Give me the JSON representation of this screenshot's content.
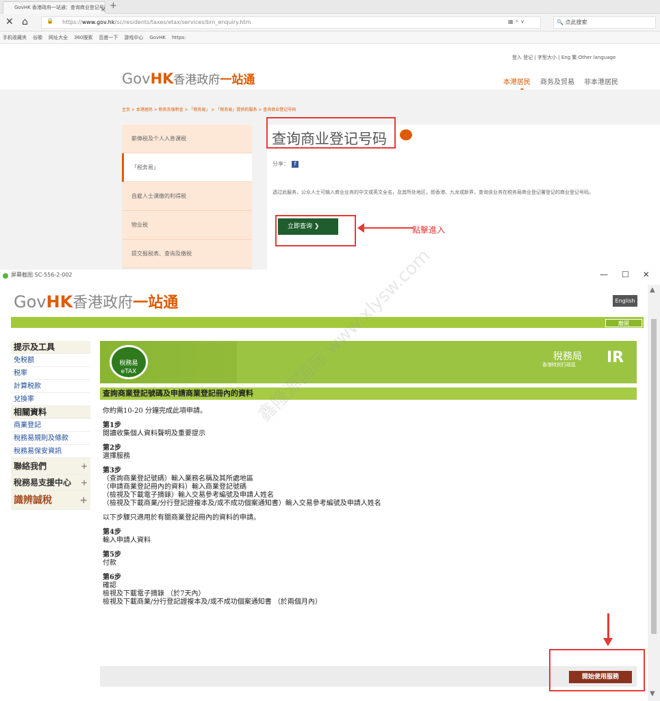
{
  "browser": {
    "tab_title": "GovHK 香港政府一站通：查询商业登记号码",
    "url_prefix": "https://",
    "url_host": "www.gov.hk",
    "url_path": "/sc/residents/taxes/etax/services/brn_enquiry.htm",
    "search_placeholder": "点此搜索",
    "bookmarks": [
      "手机收藏夹",
      "谷歌",
      "网址大全",
      "360搜索",
      "百度一下",
      "游戏中心",
      "GovHK",
      "https:"
    ]
  },
  "page1": {
    "top_tools": "登入 登记 | 字型大小 | Eng 繁 Other language",
    "logo_gov": "Gov",
    "logo_hk": "HK",
    "logo_cn": "香港政府",
    "logo_cn2": "一站通",
    "nav": [
      "本港居民",
      "商务及贸易",
      "非本港居民"
    ],
    "breadcrumb": "主页 > 本港居民 > 税务及强积金 > 「税务易」 > 「税务易」提供的服务 > 查询商业登记号码",
    "sidebar": [
      "薪俸税及个人入息课税",
      "「税务易」",
      "自雇人士课缴的利得税",
      "物业税",
      "提交报税表、查询及缴税"
    ],
    "title": "查询商业登记号码",
    "share_label": "分享：",
    "description": "透过此服务，公众人士可输入商业业务的中文或英文全名，及其所处地区，即香港、九龙或新界，查询该业务在税务局商业登记署登记的商业登记号码。",
    "enquire_button": "立即查询",
    "annotation_click": "點擊進入"
  },
  "window2": {
    "title": "屏幕截图 SC-556-2-002",
    "logo_gov": "Gov",
    "logo_hk": "HK",
    "logo_cn": "香港政府",
    "logo_cn2": "一站通",
    "english_button": "English",
    "leave_button": "離開",
    "sidebar": [
      {
        "label": "提示及工具",
        "style": "hd"
      },
      {
        "label": "免税额",
        "style": "link"
      },
      {
        "label": "税率",
        "style": "link"
      },
      {
        "label": "計算税款",
        "style": "link"
      },
      {
        "label": "兌換率",
        "style": "link"
      },
      {
        "label": "相關資料",
        "style": "hd"
      },
      {
        "label": "商業登記",
        "style": "link"
      },
      {
        "label": "稅務易規則及條款",
        "style": "link"
      },
      {
        "label": "稅務易保安資訊",
        "style": "link"
      },
      {
        "label": "聯絡我們",
        "style": "big"
      },
      {
        "label": "稅務易支援中心",
        "style": "big"
      },
      {
        "label": "識辨誠稅",
        "style": "art"
      }
    ],
    "banner_seal": "稅務易 eTAX",
    "ird_name": "稅務局",
    "ird_sub": "香港特別行政區",
    "ird_logo": "IR",
    "heading": "查詢商業登記號碼及申請商業登記冊內的資料",
    "intro": "你約需10-20 分鐘完成此項申請。",
    "steps": [
      {
        "title": "第1步",
        "lines": [
          "閱讀收集個人資料聲明及重要提示"
        ]
      },
      {
        "title": "第2步",
        "lines": [
          "選擇服務"
        ]
      },
      {
        "title": "第3步",
        "lines": [
          "（查詢商業登記號碼）輸入業務名稱及其所處地區",
          "（申請商業登記冊內的資料）輸入商業登記號碼",
          "（檢視及下載電子摘錄）輸入交易參考編號及申請人姓名",
          "（檢視及下載商業/分行登記證複本及/或不成功個案通知書）輸入交易參考編號及申請人姓名"
        ]
      }
    ],
    "note": "以下步驟只適用於有關商業登記冊內的資料的申請。",
    "steps2": [
      {
        "title": "第4步",
        "lines": [
          "輸入申請人資料"
        ]
      },
      {
        "title": "第5步",
        "lines": [
          "付款"
        ]
      },
      {
        "title": "第6步",
        "lines": [
          "確認",
          "檢視及下載電子摘錄 （於7天內）",
          "檢視及下載商業/分行登記證複本及/或不成功個案通知書 （於兩個月內）"
        ]
      }
    ],
    "start_button": "開始使用服務",
    "watermark": "鑫隆源国际 www.xlysw.com"
  },
  "colors": {
    "accent": "#e05a00",
    "govgreen": "#a2c93a",
    "annotation": "#e53935",
    "start_btn": "#8a3420"
  }
}
